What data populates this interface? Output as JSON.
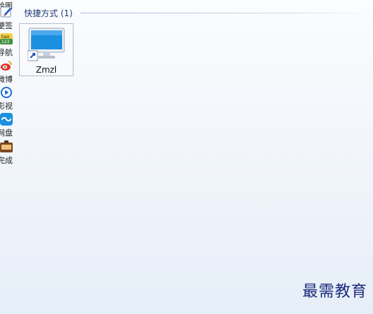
{
  "sidebar": {
    "items": [
      {
        "label": "绘图",
        "icon": "paint-icon",
        "color": "#d24a3a"
      },
      {
        "label": "便签",
        "icon": "note-pencil-icon",
        "color": "#2a5fd0"
      },
      {
        "label": "导航",
        "icon": "hao123-icon",
        "color": "#3e8f3e"
      },
      {
        "label": "微博",
        "icon": "weibo-icon",
        "color": "#e6322c"
      },
      {
        "label": "影视",
        "icon": "video-play-icon",
        "color": "#1e6ed6"
      },
      {
        "label": "网盘",
        "icon": "cloud-disk-icon",
        "color": "#1c8fe0"
      },
      {
        "label": "完成",
        "icon": "toolbox-icon",
        "color": "#7b4a24"
      }
    ]
  },
  "group": {
    "title": "快捷方式 (1)"
  },
  "shortcut": {
    "label": "Zmzl",
    "icon": "monitor-shortcut-icon",
    "accent": "#1b8fe0"
  },
  "watermark": "最需教育"
}
